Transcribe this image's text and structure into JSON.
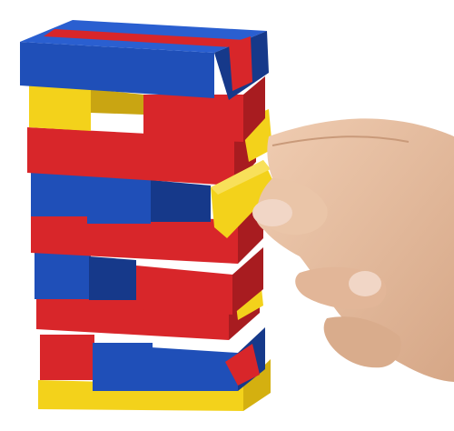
{
  "scene": {
    "subject": "stacked-block-tower",
    "colors": {
      "background": "#ffffff",
      "blue": "#1f4fb8",
      "blue_shadow": "#16398a",
      "red": "#d8262a",
      "red_shadow": "#a81c20",
      "yellow": "#f3d21b",
      "yellow_shadow": "#d4b010",
      "skin": "#e9c2a4",
      "skin_shadow": "#c99a7a",
      "nail": "#f1d6c6"
    },
    "layers": [
      {
        "row": 1,
        "pieces": [
          "blue",
          "red",
          "blue"
        ]
      },
      {
        "row": 2,
        "pieces": [
          "yellow",
          "red",
          "yellow"
        ]
      },
      {
        "row": 3,
        "pieces": [
          "red",
          "blue",
          "yellow"
        ]
      },
      {
        "row": 4,
        "pieces": [
          "blue",
          "blue",
          "yellow"
        ]
      },
      {
        "row": 5,
        "pieces": [
          "red",
          "yellow"
        ]
      },
      {
        "row": 6,
        "pieces": [
          "blue",
          "red",
          "yellow"
        ]
      },
      {
        "row": 7,
        "pieces": [
          "red",
          "yellow"
        ]
      },
      {
        "row": 8,
        "pieces": [
          "red",
          "blue",
          "blue"
        ]
      },
      {
        "row": 9,
        "pieces": [
          "yellow",
          "yellow"
        ]
      }
    ]
  }
}
